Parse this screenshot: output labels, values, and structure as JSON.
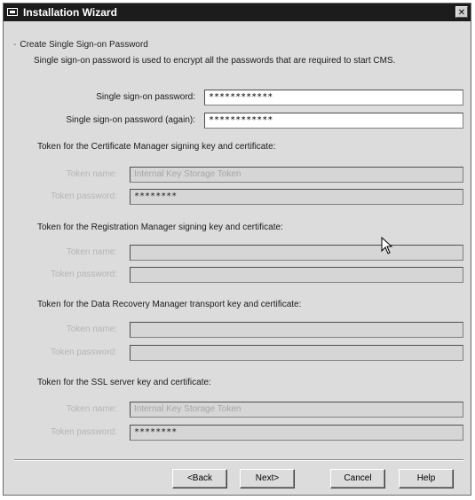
{
  "window": {
    "title": "Installation Wizard",
    "close_glyph": "✕"
  },
  "group": {
    "title": "Create Single Sign-on Password",
    "description": "Single sign-on password is used to encrypt all the passwords that are required to start CMS."
  },
  "password": {
    "label": "Single sign-on password:",
    "value": "************"
  },
  "password_again": {
    "label": "Single sign-on password (again):",
    "value": "************"
  },
  "sections": [
    {
      "heading": "Token for the Certificate Manager signing key and certificate:",
      "token_label": "Token name:",
      "token_value": "Internal Key Storage Token",
      "password_label": "Token password:",
      "password_value": "********"
    },
    {
      "heading": "Token for the Registration Manager signing key and certificate:",
      "token_label": "Token name:",
      "token_value": "",
      "password_label": "Token password:",
      "password_value": ""
    },
    {
      "heading": "Token for the Data Recovery Manager transport key and certificate:",
      "token_label": "Token name:",
      "token_value": "",
      "password_label": "Token password:",
      "password_value": ""
    },
    {
      "heading": "Token for the SSL server key and certificate:",
      "token_label": "Token name:",
      "token_value": "Internal Key Storage Token",
      "password_label": "Token password:",
      "password_value": "********"
    }
  ],
  "buttons": {
    "back": "<Back",
    "next": "Next>",
    "cancel": "Cancel",
    "help": "Help"
  },
  "colors": {
    "titlebar": "#1c1c1c",
    "dialog_bg": "#dcdcdc",
    "disabled_text": "#b5b5b5"
  }
}
